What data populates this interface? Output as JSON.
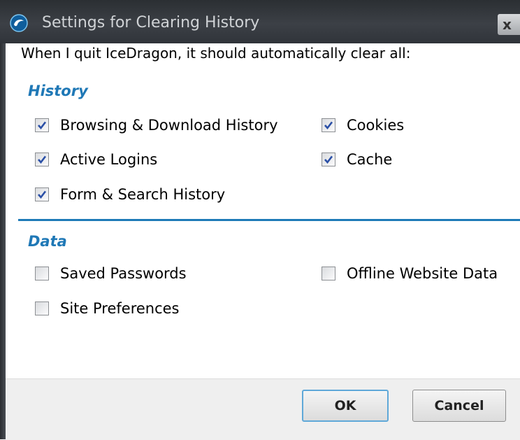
{
  "window": {
    "title": "Settings for Clearing History",
    "close_label": "x"
  },
  "intro_text": "When I quit IceDragon, it should automatically clear all:",
  "history_section": {
    "title": "History",
    "items": [
      {
        "label": "Browsing & Download History",
        "checked": true
      },
      {
        "label": "Cookies",
        "checked": true
      },
      {
        "label": "Active Logins",
        "checked": true
      },
      {
        "label": "Cache",
        "checked": true
      },
      {
        "label": "Form & Search History",
        "checked": true
      }
    ]
  },
  "data_section": {
    "title": "Data",
    "items": [
      {
        "label": "Saved Passwords",
        "checked": false
      },
      {
        "label": "Offline Website Data",
        "checked": false
      },
      {
        "label": "Site Preferences",
        "checked": false
      }
    ]
  },
  "buttons": {
    "ok_label": "OK",
    "cancel_label": "Cancel"
  },
  "colors": {
    "accent": "#1f78b6",
    "check": "#2a4fa6"
  }
}
